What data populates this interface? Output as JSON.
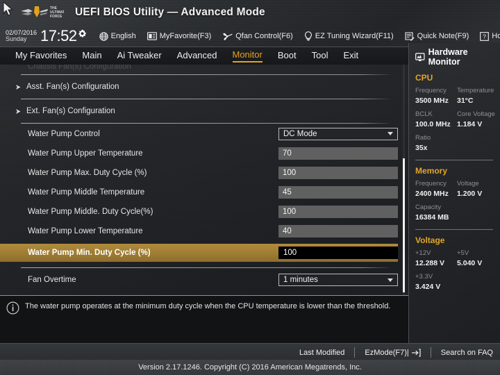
{
  "header": {
    "app_title": "UEFI BIOS Utility — Advanced Mode",
    "logo_text_1": "THE",
    "logo_text_2": "ULTIMATE",
    "logo_text_3": "FORCE",
    "date": "02/07/2016",
    "day": "Sunday",
    "time": "17:52",
    "gear_icon": "gear-icon",
    "cursor_icon": "mouse-cursor",
    "tools": [
      {
        "label": "English",
        "icon": "globe-icon"
      },
      {
        "label": "MyFavorite(F3)",
        "icon": "star-window-icon"
      },
      {
        "label": "Qfan Control(F6)",
        "icon": "fan-icon"
      },
      {
        "label": "EZ Tuning Wizard(F11)",
        "icon": "lightbulb-icon"
      },
      {
        "label": "Quick Note(F9)",
        "icon": "note-pencil-icon"
      },
      {
        "label": "Hot Keys",
        "icon": "question-box-icon"
      }
    ]
  },
  "tabs": [
    {
      "label": "My Favorites",
      "active": false
    },
    {
      "label": "Main",
      "active": false
    },
    {
      "label": "Ai Tweaker",
      "active": false
    },
    {
      "label": "Advanced",
      "active": false
    },
    {
      "label": "Monitor",
      "active": true
    },
    {
      "label": "Boot",
      "active": false
    },
    {
      "label": "Tool",
      "active": false
    },
    {
      "label": "Exit",
      "active": false
    }
  ],
  "content": {
    "clipped_row_label": "Chassis Fan(s) Configuration",
    "rows": [
      {
        "label": "Asst. Fan(s) Configuration",
        "type": "submenu",
        "value": "",
        "selected": false
      },
      {
        "label": "Ext. Fan(s) Configuration",
        "type": "submenu",
        "value": "",
        "selected": false
      },
      {
        "label": "Water Pump Control",
        "type": "select",
        "value": "DC Mode",
        "selected": false
      },
      {
        "label": "Water Pump Upper Temperature",
        "type": "text",
        "value": "70",
        "selected": false
      },
      {
        "label": "Water Pump Max. Duty Cycle (%)",
        "type": "text",
        "value": "100",
        "selected": false
      },
      {
        "label": "Water Pump Middle Temperature",
        "type": "text",
        "value": "45",
        "selected": false
      },
      {
        "label": "Water Pump Middle. Duty Cycle(%)",
        "type": "text",
        "value": "100",
        "selected": false
      },
      {
        "label": "Water Pump Lower Temperature",
        "type": "text",
        "value": "40",
        "selected": false
      },
      {
        "label": "Water Pump Min. Duty Cycle (%)",
        "type": "text",
        "value": "100",
        "selected": true
      },
      {
        "label": "Fan Overtime",
        "type": "select",
        "value": "1 minutes",
        "selected": false
      }
    ]
  },
  "help": {
    "icon": "info-icon",
    "text": "The water pump operates at the minimum duty cycle when the CPU temperature is lower than the threshold."
  },
  "sidebar": {
    "title": "Hardware Monitor",
    "title_icon": "monitor-icon",
    "sections": [
      {
        "name": "CPU",
        "items": [
          {
            "key": "Frequency",
            "value": "3500 MHz",
            "full": false
          },
          {
            "key": "Temperature",
            "value": "31°C",
            "full": false
          },
          {
            "key": "BCLK",
            "value": "100.0 MHz",
            "full": false
          },
          {
            "key": "Core Voltage",
            "value": "1.184 V",
            "full": false
          },
          {
            "key": "Ratio",
            "value": "35x",
            "full": true
          }
        ]
      },
      {
        "name": "Memory",
        "items": [
          {
            "key": "Frequency",
            "value": "2400 MHz",
            "full": false
          },
          {
            "key": "Voltage",
            "value": "1.200 V",
            "full": false
          },
          {
            "key": "Capacity",
            "value": "16384 MB",
            "full": true
          }
        ]
      },
      {
        "name": "Voltage",
        "items": [
          {
            "key": "+12V",
            "value": "12.288 V",
            "full": false
          },
          {
            "key": "+5V",
            "value": "5.040 V",
            "full": false
          },
          {
            "key": "+3.3V",
            "value": "3.424 V",
            "full": true
          }
        ]
      }
    ]
  },
  "footer": {
    "last_modified": "Last Modified",
    "ez_mode": "EzMode(F7)|",
    "ez_mode_icon": "arrow-into-bracket-icon",
    "search_faq": "Search on FAQ",
    "version": "Version 2.17.1246. Copyright (C) 2016 American Megatrends, Inc."
  },
  "colors": {
    "accent": "#e8a321",
    "selected_row": "#9e7c33",
    "field_bg": "#606060",
    "panel_bg": "#232528"
  }
}
